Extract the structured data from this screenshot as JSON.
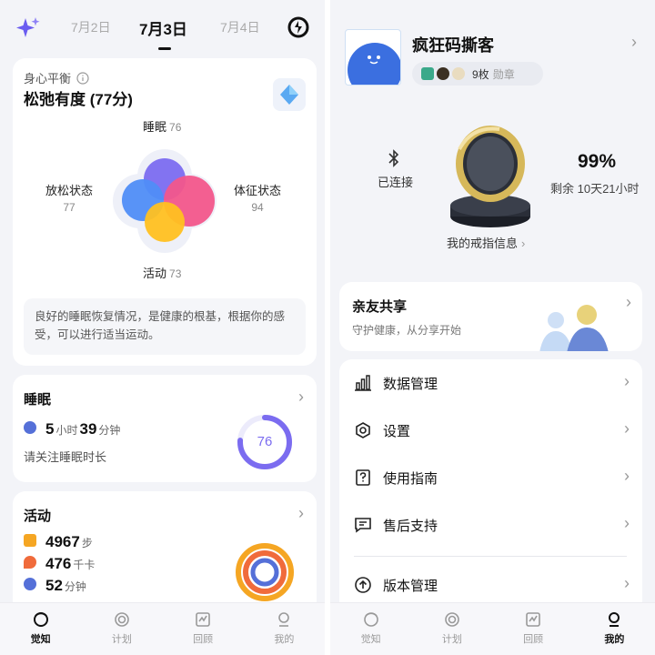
{
  "left": {
    "dates": {
      "prev": "7月2日",
      "current": "7月3日",
      "next": "7月4日"
    },
    "balance": {
      "label": "身心平衡",
      "title": "松弛有度 (77分)",
      "sleep": {
        "label": "睡眠",
        "value": "76"
      },
      "relax": {
        "label": "放松状态",
        "value": "77"
      },
      "vitals": {
        "label": "体征状态",
        "value": "94"
      },
      "activity": {
        "label": "活动",
        "value": "73"
      },
      "advice": "良好的睡眠恢复情况，是健康的根基，根据你的感受，可以进行适当运动。"
    },
    "sleep_card": {
      "title": "睡眠",
      "hours": "5",
      "hours_unit": "小时",
      "minutes": "39",
      "minutes_unit": "分钟",
      "note": "请关注睡眠时长",
      "score": "76",
      "score_fraction": 0.76
    },
    "activity_card": {
      "title": "活动",
      "steps": "4967",
      "steps_unit": "步",
      "kcal": "476",
      "kcal_unit": "千卡",
      "minutes": "52",
      "minutes_unit": "分钟"
    },
    "tabs": [
      "觉知",
      "计划",
      "回顾",
      "我的"
    ],
    "active_tab": "觉知"
  },
  "right": {
    "profile": {
      "name": "疯狂码撕客",
      "badge_count": "9枚",
      "badge_label": "勋章"
    },
    "ring": {
      "connection": "已连接",
      "battery": "99%",
      "remaining": "剩余 10天21小时",
      "info_link": "我的戒指信息"
    },
    "share": {
      "title": "亲友共享",
      "subtitle": "守护健康，从分享开始"
    },
    "menu": [
      {
        "label": "数据管理",
        "icon": "bar-chart-icon"
      },
      {
        "label": "设置",
        "icon": "hexagon-settings-icon"
      },
      {
        "label": "使用指南",
        "icon": "guide-icon"
      },
      {
        "label": "售后支持",
        "icon": "chat-support-icon"
      },
      {
        "label": "版本管理",
        "icon": "upgrade-icon"
      }
    ],
    "tabs": [
      "觉知",
      "计划",
      "回顾",
      "我的"
    ],
    "active_tab": "我的"
  },
  "colors": {
    "sleep_petal": "#7b6cf0",
    "relax_petal": "#4f8df7",
    "vitals_petal": "#f2568b",
    "activity_petal": "#ffc021",
    "steps_color": "#f5a623",
    "kcal_color": "#f06b3b",
    "min_color": "#5570d8"
  }
}
